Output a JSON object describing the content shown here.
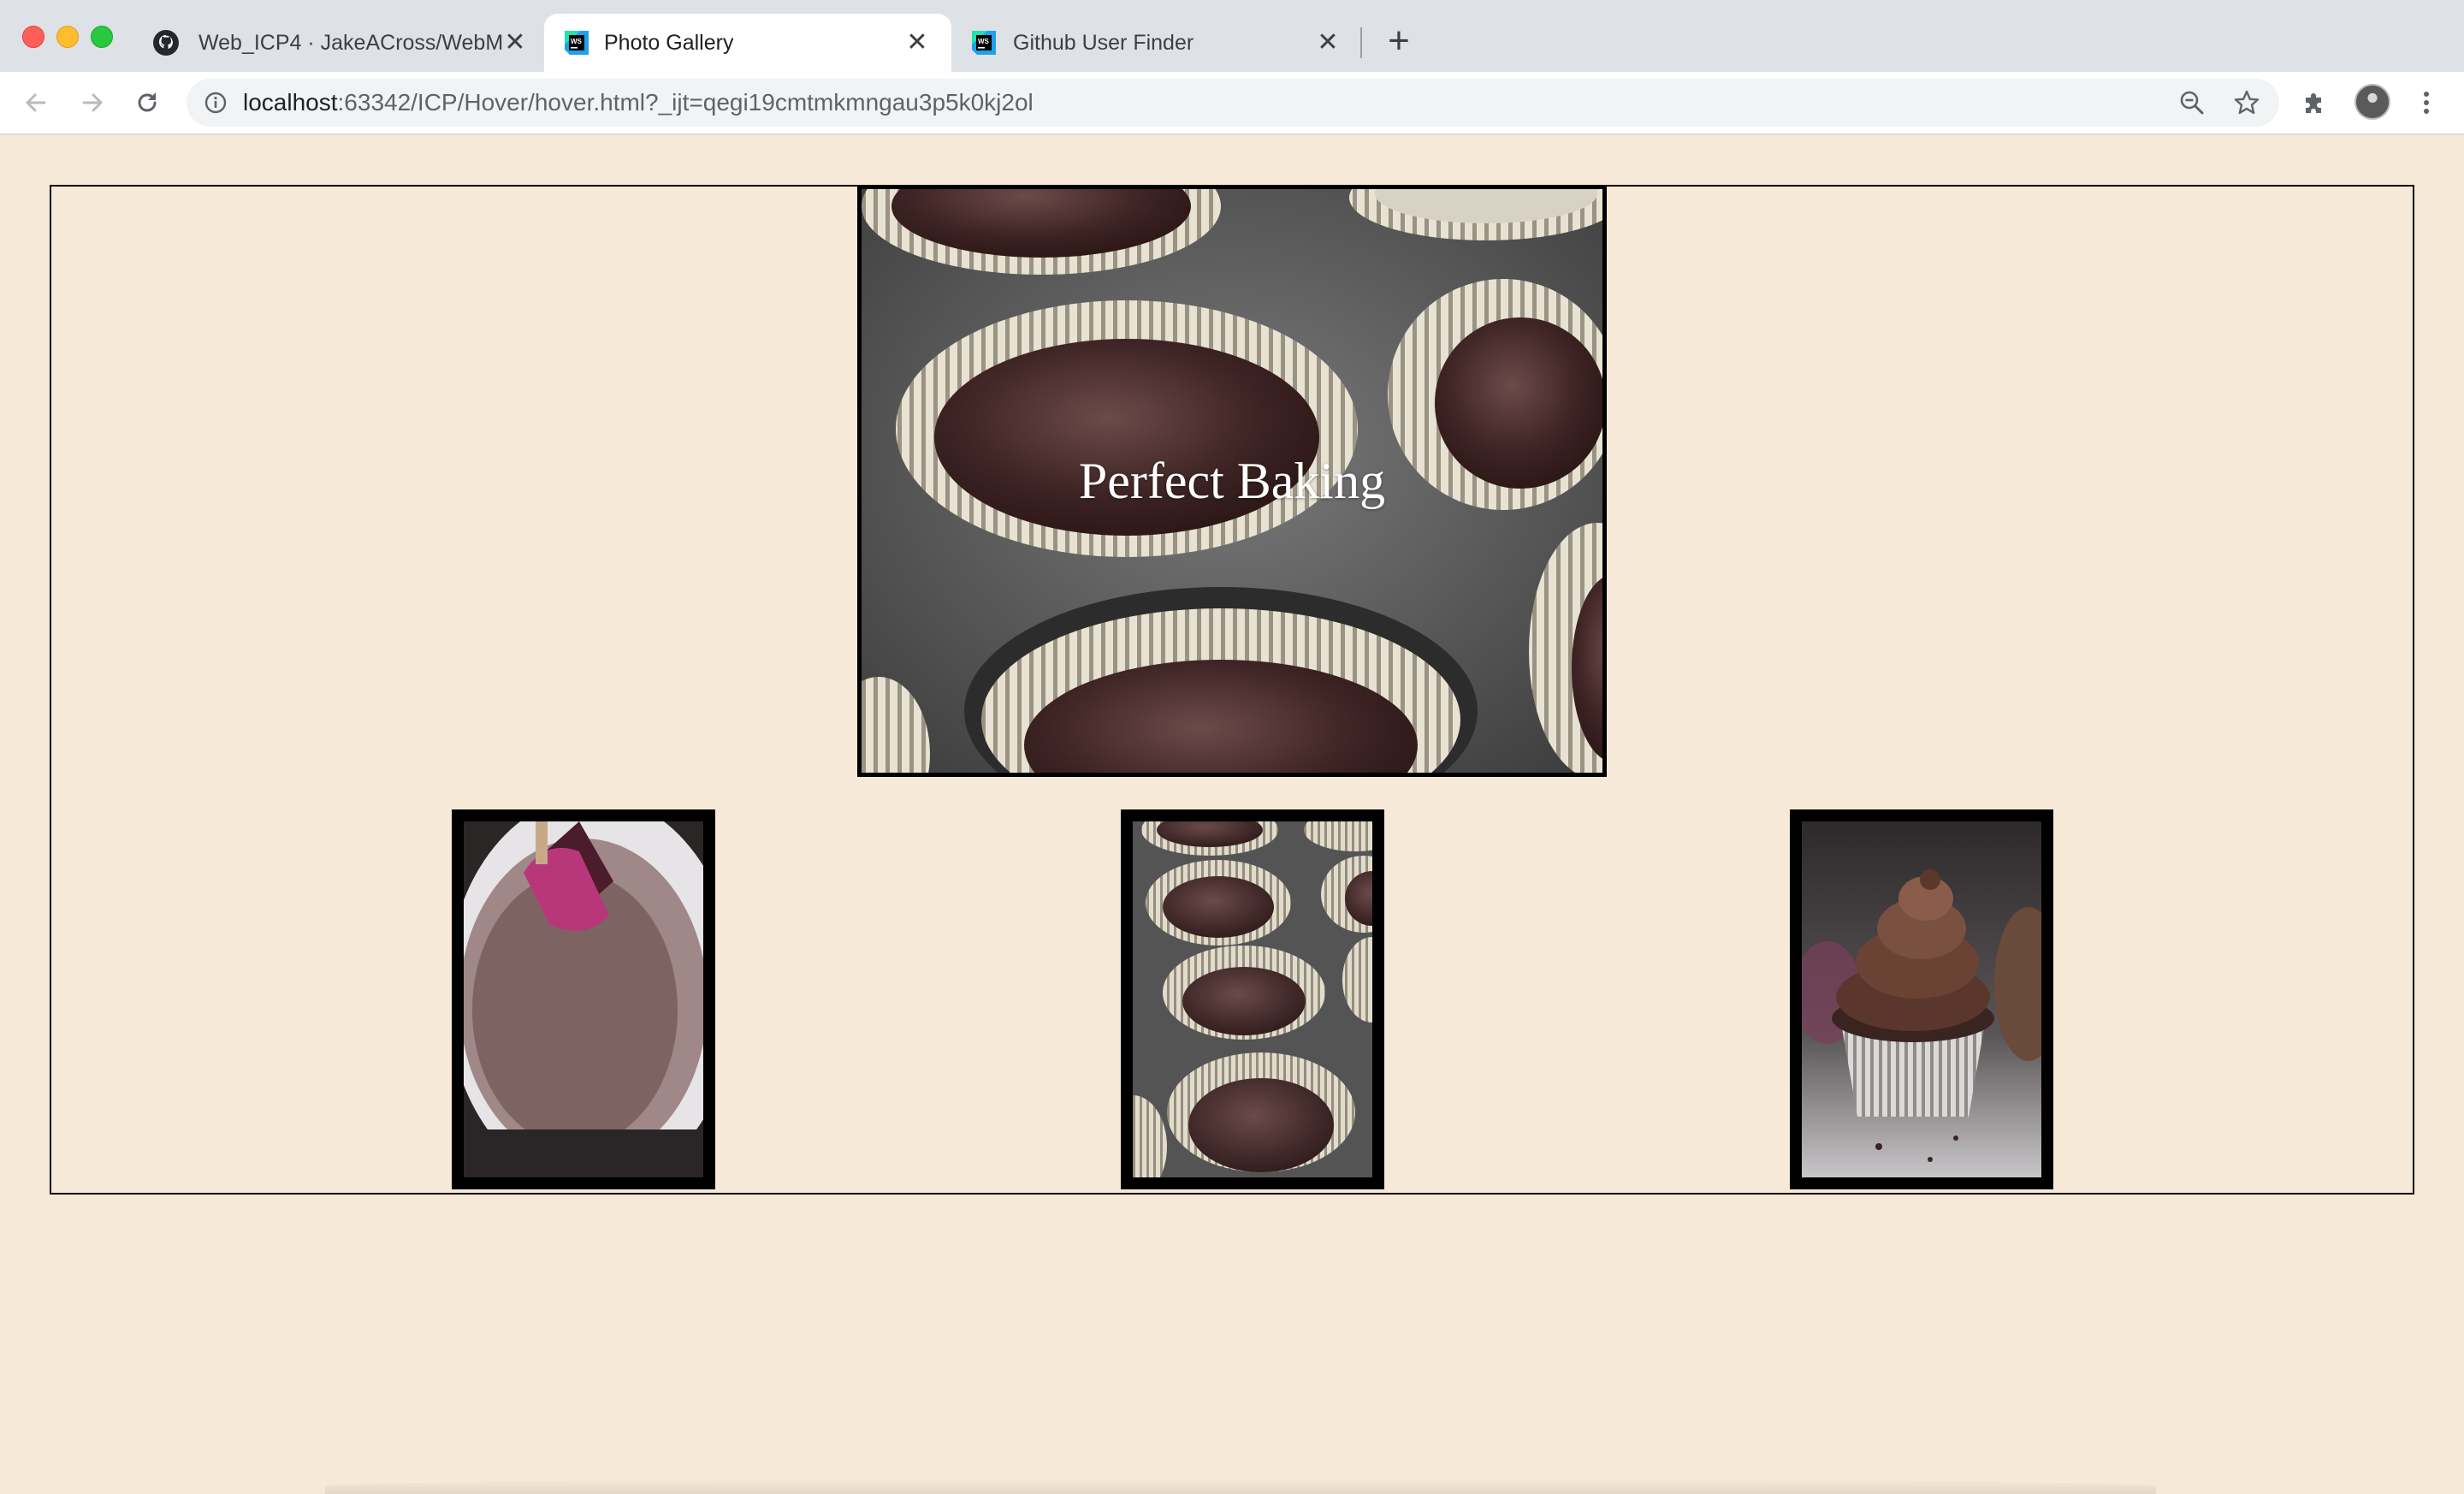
{
  "browser": {
    "tabs": [
      {
        "title": "Web_ICP4 · JakeACross/WebM",
        "icon": "github-icon"
      },
      {
        "title": "Photo Gallery",
        "icon": "webstorm-icon",
        "active": true
      },
      {
        "title": "Github User Finder",
        "icon": "webstorm-icon"
      }
    ],
    "url_host": "localhost",
    "url_path": ":63342/ICP/Hover/hover.html?_ijt=qegi19cmtmkmngau3p5k0kj2ol"
  },
  "gallery": {
    "hero_caption": "Perfect Baking",
    "thumbnails": [
      {
        "subject": "chocolate batter bowl with spatula"
      },
      {
        "subject": "cupcake tin with batter"
      },
      {
        "subject": "chocolate frosted cupcake"
      }
    ]
  },
  "colors": {
    "page_background": "#f6e9d8",
    "border": "#000000",
    "caption": "#ffffff"
  }
}
